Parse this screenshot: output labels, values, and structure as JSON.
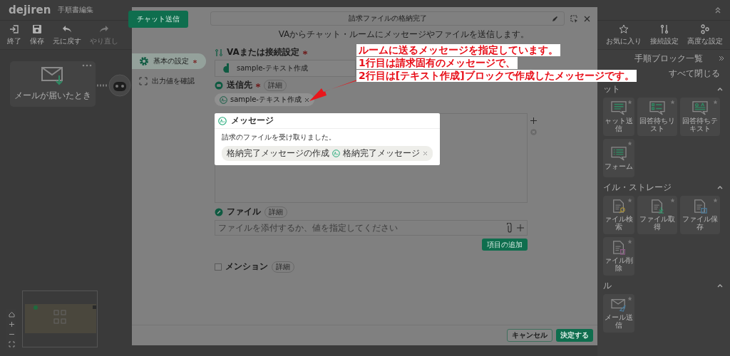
{
  "app": {
    "logo": "dejiren",
    "title": "手順書編集"
  },
  "toolbar": [
    {
      "label": "終了",
      "kind": "exit",
      "disabled": false
    },
    {
      "label": "保存",
      "kind": "save",
      "disabled": false
    },
    {
      "label": "元に戻す",
      "kind": "undo",
      "disabled": false
    },
    {
      "label": "やり直し",
      "kind": "redo",
      "disabled": true
    }
  ],
  "toolbar_right": [
    {
      "label": "お気に入り",
      "kind": "star"
    },
    {
      "label": "接続設定",
      "kind": "connect"
    },
    {
      "label": "高度な設定",
      "kind": "settings"
    }
  ],
  "canvas": {
    "node": {
      "label": "メールが届いたとき"
    }
  },
  "panel": {
    "title": "手順ブロック一覧",
    "collapse_all": "すべて閉じる",
    "groups": [
      {
        "title": "ット",
        "expanded": true,
        "items": [
          {
            "label": "ャット送信",
            "kind": "chat"
          },
          {
            "label": "回答待ちリスト",
            "kind": "list"
          },
          {
            "label": "回答待ちテキスト",
            "kind": "qa"
          },
          {
            "label": "フォーム",
            "kind": "form"
          }
        ]
      },
      {
        "title": "イル・ストレージ",
        "expanded": true,
        "items": [
          {
            "label": "ァイル検索",
            "kind": "file-search"
          },
          {
            "label": "ファイル取得",
            "kind": "file-get"
          },
          {
            "label": "ファイル保存",
            "kind": "file-save"
          },
          {
            "label": "ァイル削除",
            "kind": "file-delete"
          }
        ]
      },
      {
        "title": "ル",
        "expanded": true,
        "items": [
          {
            "label": "メール送信",
            "kind": "mail"
          }
        ]
      }
    ]
  },
  "dialog": {
    "tab": "チャット送信",
    "title": "請求ファイルの格納完了",
    "subtitle": "VAからチャット・ルームにメッセージやファイルを送信します。",
    "nav": [
      {
        "label": "基本の設定",
        "required": true,
        "selected": true,
        "kind": "settings"
      },
      {
        "label": "出力値を確認",
        "required": false,
        "selected": false,
        "kind": "output"
      }
    ],
    "connection": {
      "label": "VAまたは接続設定",
      "required": true,
      "value": "sample-テキスト作成"
    },
    "recipient": {
      "label": "送信先",
      "required": true,
      "detail": "詳細",
      "chips": [
        "sample-テキスト作成"
      ]
    },
    "message": {
      "label": "メッセージ",
      "text": "請求のファイルを受け取りました。",
      "chip": {
        "source": "格納完了メッセージの作成",
        "value": "格納完了メッセージ"
      }
    },
    "file": {
      "label": "ファイル",
      "detail": "詳細",
      "placeholder": "ファイルを添付するか、値を指定してください"
    },
    "add_item": "項目の追加",
    "mention": {
      "label": "メンション",
      "detail": "詳細",
      "checked": false
    },
    "buttons": [
      {
        "label": "キャンセル",
        "kind": "secondary"
      },
      {
        "label": "決定する",
        "kind": "primary"
      }
    ]
  },
  "annotation": {
    "lines": [
      "ルームに送るメッセージを指定しています。",
      "1行目は請求固有のメッセージで、",
      "2行目は[テキスト作成]ブロックで作成したメッセージです。"
    ]
  }
}
